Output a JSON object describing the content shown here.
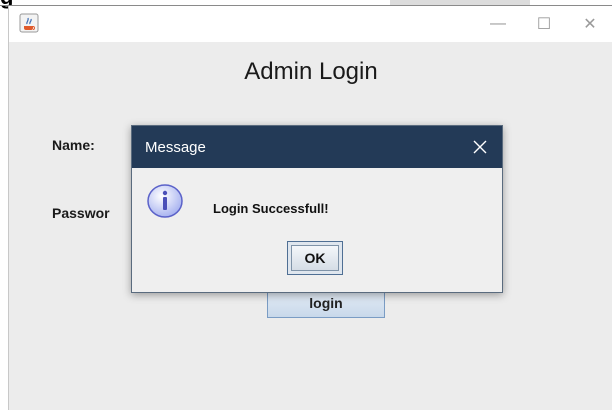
{
  "background": {
    "title_fragment": "g"
  },
  "window": {
    "controls": {
      "minimize": "—",
      "maximize": "☐",
      "close": "✕"
    }
  },
  "form": {
    "heading": "Admin Login",
    "name_label": "Name:",
    "password_label": "Passwor",
    "login_button": "login"
  },
  "dialog": {
    "title": "Message",
    "message": "Login Successfull!",
    "ok_button": "OK",
    "icon": "info-icon"
  },
  "colors": {
    "dialog_titlebar": "#233a57",
    "window_bg": "#ececec",
    "login_button_border": "#7a9cc4"
  }
}
